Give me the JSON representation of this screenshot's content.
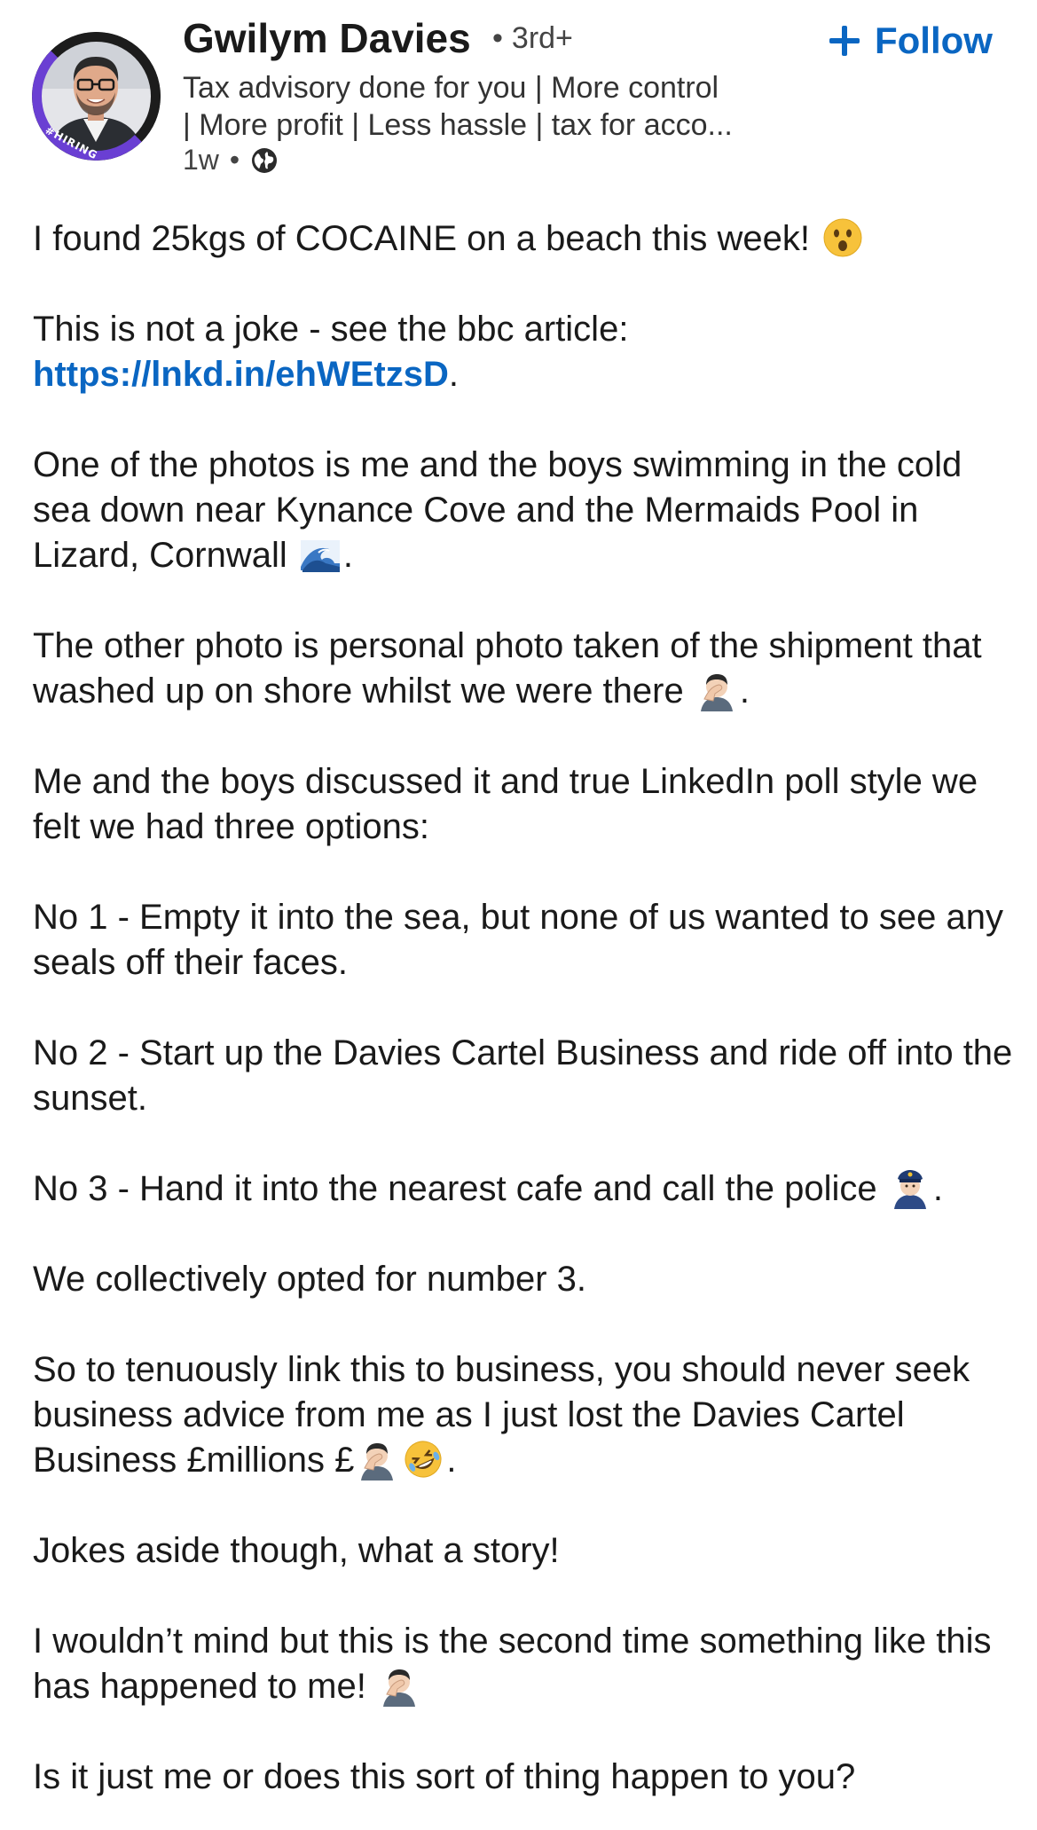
{
  "author": {
    "name": "Gwilym Davies",
    "degree": "3rd+",
    "headline": "Tax advisory done for you | More control\n| More profit | Less hassle | tax for acco...",
    "time": "1w",
    "hiring_badge": "#HIRING"
  },
  "follow": {
    "label": "Follow"
  },
  "post": {
    "p1": {
      "text": "I found 25kgs of COCAINE on a beach this week!"
    },
    "p2": {
      "text": "This is not a joke - see the bbc article: ",
      "link": "https://lnkd.in/ehWEtzsD",
      "after": "."
    },
    "p3": {
      "text": "One of the photos is me and the boys swimming in the cold sea down near Kynance Cove and the Mermaids Pool in Lizard, Cornwall",
      "after": "."
    },
    "p4": {
      "text": "The other photo is personal photo taken of the shipment that washed up on shore whilst we were there",
      "after": "."
    },
    "p5": {
      "text": "Me and the boys discussed it and true LinkedIn poll style we felt we had three options:"
    },
    "p6": {
      "text": "No 1 - Empty it into the sea, but none of us wanted to see any seals off their faces."
    },
    "p7": {
      "text": "No 2 - Start up the Davies Cartel Business and ride off into the sunset."
    },
    "p8": {
      "text": "No 3 - Hand it into the nearest cafe and call the police",
      "after": "."
    },
    "p9": {
      "text": "We collectively opted for number 3."
    },
    "p10": {
      "text": "So to tenuously link this to business, you should never seek business advice from me as I just lost the Davies Cartel Business £millions £",
      "after": "."
    },
    "p11": {
      "text": "Jokes aside though, what a story!"
    },
    "p12": {
      "text": "I wouldn’t mind but this is the second time something like this has happened to me!"
    },
    "p13": {
      "text": "Is it just me or does this sort of thing happen to you?"
    }
  },
  "icons": {
    "surprised": "surprised-face-emoji",
    "wave": "water-wave-emoji",
    "facepalm": "man-facepalming-emoji",
    "police": "police-officer-emoji",
    "rofl": "rolling-on-floor-laughing-emoji",
    "globe": "globe-icon",
    "plus": "plus-icon"
  },
  "colors": {
    "link": "#0a66c2",
    "hiring_ring": "#6a3fd3",
    "text": "#1a1a1a"
  }
}
